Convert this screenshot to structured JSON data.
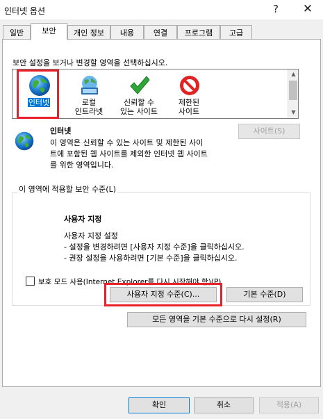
{
  "window": {
    "title": "인터넷 옵션",
    "help_glyph": "?",
    "close_glyph": "✕"
  },
  "tabs": [
    {
      "label": "일반"
    },
    {
      "label": "보안"
    },
    {
      "label": "개인 정보"
    },
    {
      "label": "내용"
    },
    {
      "label": "연결"
    },
    {
      "label": "프로그램"
    },
    {
      "label": "고급"
    }
  ],
  "instruction": "보안 설정을 보거나 변경할 영역을 선택하십시오.",
  "zones": [
    {
      "label": "인터넷",
      "icon": "globe-icon"
    },
    {
      "label": "로컬\n인트라넷",
      "icon": "intranet-icon"
    },
    {
      "label": "신뢰할 수\n있는 사이트",
      "icon": "checkmark-icon"
    },
    {
      "label": "제한된\n사이트",
      "icon": "restricted-icon"
    }
  ],
  "zone_info": {
    "title": "인터넷",
    "lines": [
      "이 영역은 신뢰할 수 있는 사이트 및 제한된 사이",
      "트에 포함된 웹 사이트를 제외한 인터넷 웹 사이트",
      "를 위한 영역입니다."
    ],
    "sites_button": "사이트(S)"
  },
  "security_level": {
    "legend": "이 영역에 적용할 보안 수준(L)",
    "heading": "사용자 지정",
    "lines": [
      "사용자 지정 설정",
      "- 설정을 변경하려면 [사용자 지정 수준]을 클릭하십시오.",
      "- 권장 설정을 사용하려면 [기본 수준]을 클릭하십시오."
    ],
    "protected_mode_label": "보호 모드 사용(Internet Explorer를 다시 시작해야 함)(P)",
    "custom_level_button": "사용자 지정 수준(C)...",
    "default_level_button": "기본 수준(D)",
    "reset_all_button": "모든 영역을 기본 수준으로 다시 설정(R)"
  },
  "footer": {
    "ok": "확인",
    "cancel": "취소",
    "apply": "적용(A)"
  },
  "colors": {
    "highlight_box": "#e8202a",
    "selection": "#0078d7"
  }
}
